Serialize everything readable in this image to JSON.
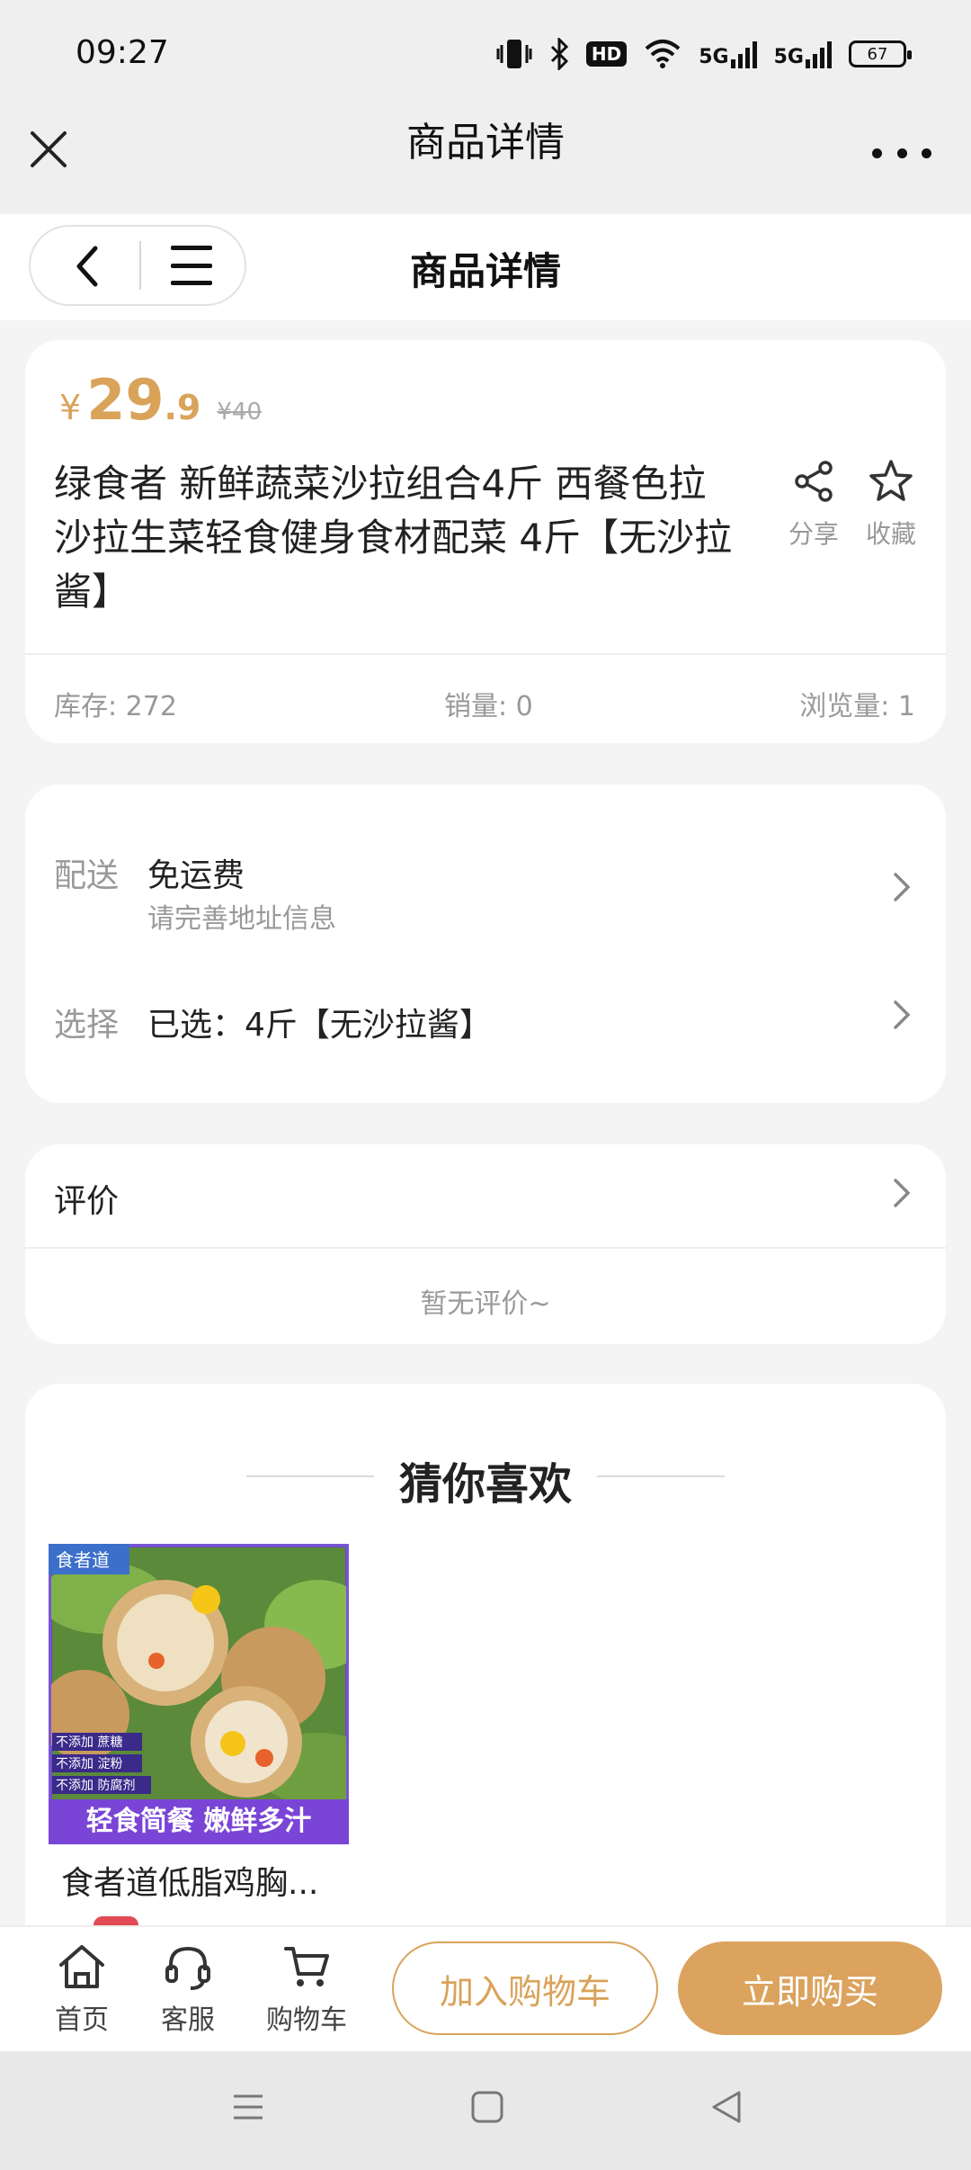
{
  "status_bar": {
    "time": "09:27",
    "hd_label": "HD",
    "net1": "5G",
    "net2": "5G",
    "battery": "67"
  },
  "mini_program_bar": {
    "title": "商品详情"
  },
  "page_header": {
    "title": "商品详情"
  },
  "product": {
    "price_symbol": "¥",
    "price_integer": "29",
    "price_decimal": ".9",
    "original_price": "¥40",
    "title": "绿食者 新鲜蔬菜沙拉组合4斤 西餐色拉沙拉生菜轻食健身食材配菜 4斤【无沙拉酱】",
    "actions": {
      "share_label": "分享",
      "favorite_label": "收藏"
    },
    "stats": {
      "stock": "库存: 272",
      "sales": "销量: 0",
      "views": "浏览量: 1"
    }
  },
  "options": {
    "delivery_label": "配送",
    "delivery_value": "免运费",
    "delivery_sub": "请完善地址信息",
    "select_label": "选择",
    "select_value": "已选：4斤【无沙拉酱】"
  },
  "reviews": {
    "label": "评价",
    "empty_text": "暂无评价~"
  },
  "recommendations": {
    "title": "猜你喜欢",
    "items": [
      {
        "name": "食者道低脂鸡胸...",
        "image_brand": "食者道",
        "image_banner": "轻食简餐 嫩鲜多汁",
        "image_tags": [
          "不添加 蔗糖",
          "不添加 淀粉",
          "不添加 防腐剂"
        ]
      }
    ]
  },
  "bottom_bar": {
    "home_label": "首页",
    "service_label": "客服",
    "cart_label": "购物车",
    "add_to_cart": "加入购物车",
    "buy_now": "立即购买"
  },
  "colors": {
    "accent": "#d9a35a",
    "buy_button": "#dba35e",
    "background": "#f4f4f4",
    "muted_text": "#999999"
  },
  "icons": {
    "close": "close-icon",
    "more": "more-dots-icon",
    "back": "back-chevron-icon",
    "menu": "menu-icon",
    "share": "share-icon",
    "favorite": "star-icon",
    "chevron": "chevron-right-icon",
    "home": "home-icon",
    "service": "headset-icon",
    "cart": "cart-icon"
  }
}
